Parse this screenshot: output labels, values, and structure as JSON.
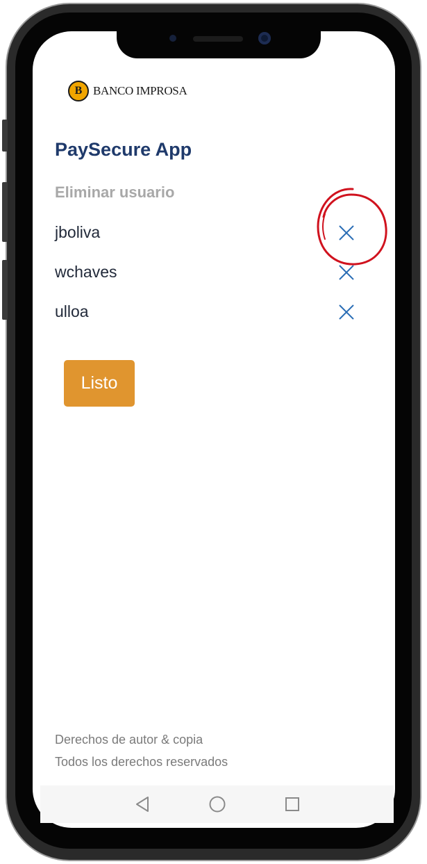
{
  "brand": {
    "logo_letter": "B",
    "logo_text": "BANCO IMPROSA"
  },
  "header": {
    "app_title": "PaySecure App",
    "subtitle": "Eliminar usuario"
  },
  "users": [
    {
      "name": "jboliva"
    },
    {
      "name": "wchaves"
    },
    {
      "name": "ulloa"
    }
  ],
  "actions": {
    "done_label": "Listo"
  },
  "footer": {
    "line1": "Derechos de autor & copia",
    "line2": "Todos los derechos reservados"
  },
  "icons": {
    "remove": "close-icon",
    "nav_back": "triangle-back-icon",
    "nav_home": "circle-home-icon",
    "nav_recents": "square-recents-icon"
  },
  "colors": {
    "title": "#1f3a6b",
    "accent_button": "#e0952f",
    "remove_icon": "#2a6db5",
    "annotation": "#d0121e"
  }
}
